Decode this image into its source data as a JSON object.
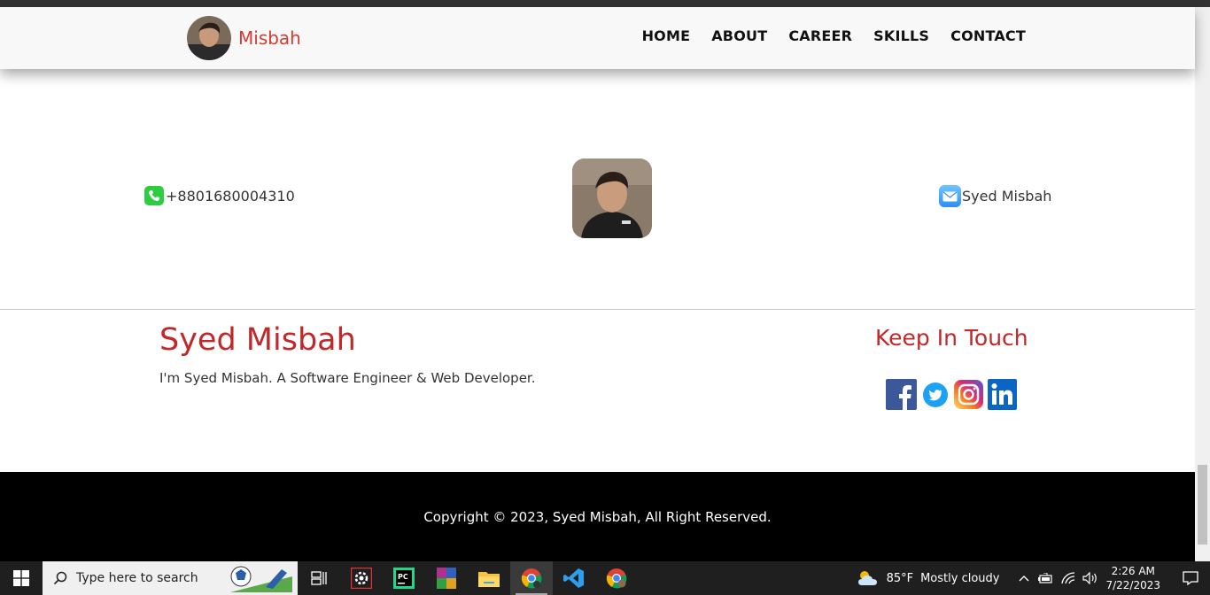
{
  "nav": {
    "brand": "Misbah",
    "links": [
      "HOME",
      "ABOUT",
      "CAREER",
      "SKILLS",
      "CONTACT"
    ]
  },
  "contact": {
    "phone": "+8801680004310",
    "email_label": "Syed Misbah",
    "phone_icon": "whatsapp-icon",
    "email_icon": "mail-icon"
  },
  "footer": {
    "name": "Syed Misbah",
    "tagline": "I'm Syed Misbah. A Software Engineer & Web Developer.",
    "keep_in_touch": "Keep In Touch",
    "socials": [
      "facebook-icon",
      "twitter-icon",
      "instagram-icon",
      "linkedin-icon"
    ],
    "copyright": "Copyright © 2023, Syed Misbah, All Right Reserved."
  },
  "taskbar": {
    "search_placeholder": "Type here to search",
    "weather": "85°F",
    "weather_desc": "Mostly cloudy",
    "time": "2:26 AM",
    "date": "7/22/2023"
  },
  "colors": {
    "accent": "#c0282a",
    "brand": "#d33b33",
    "footer_bg": "#000000"
  }
}
